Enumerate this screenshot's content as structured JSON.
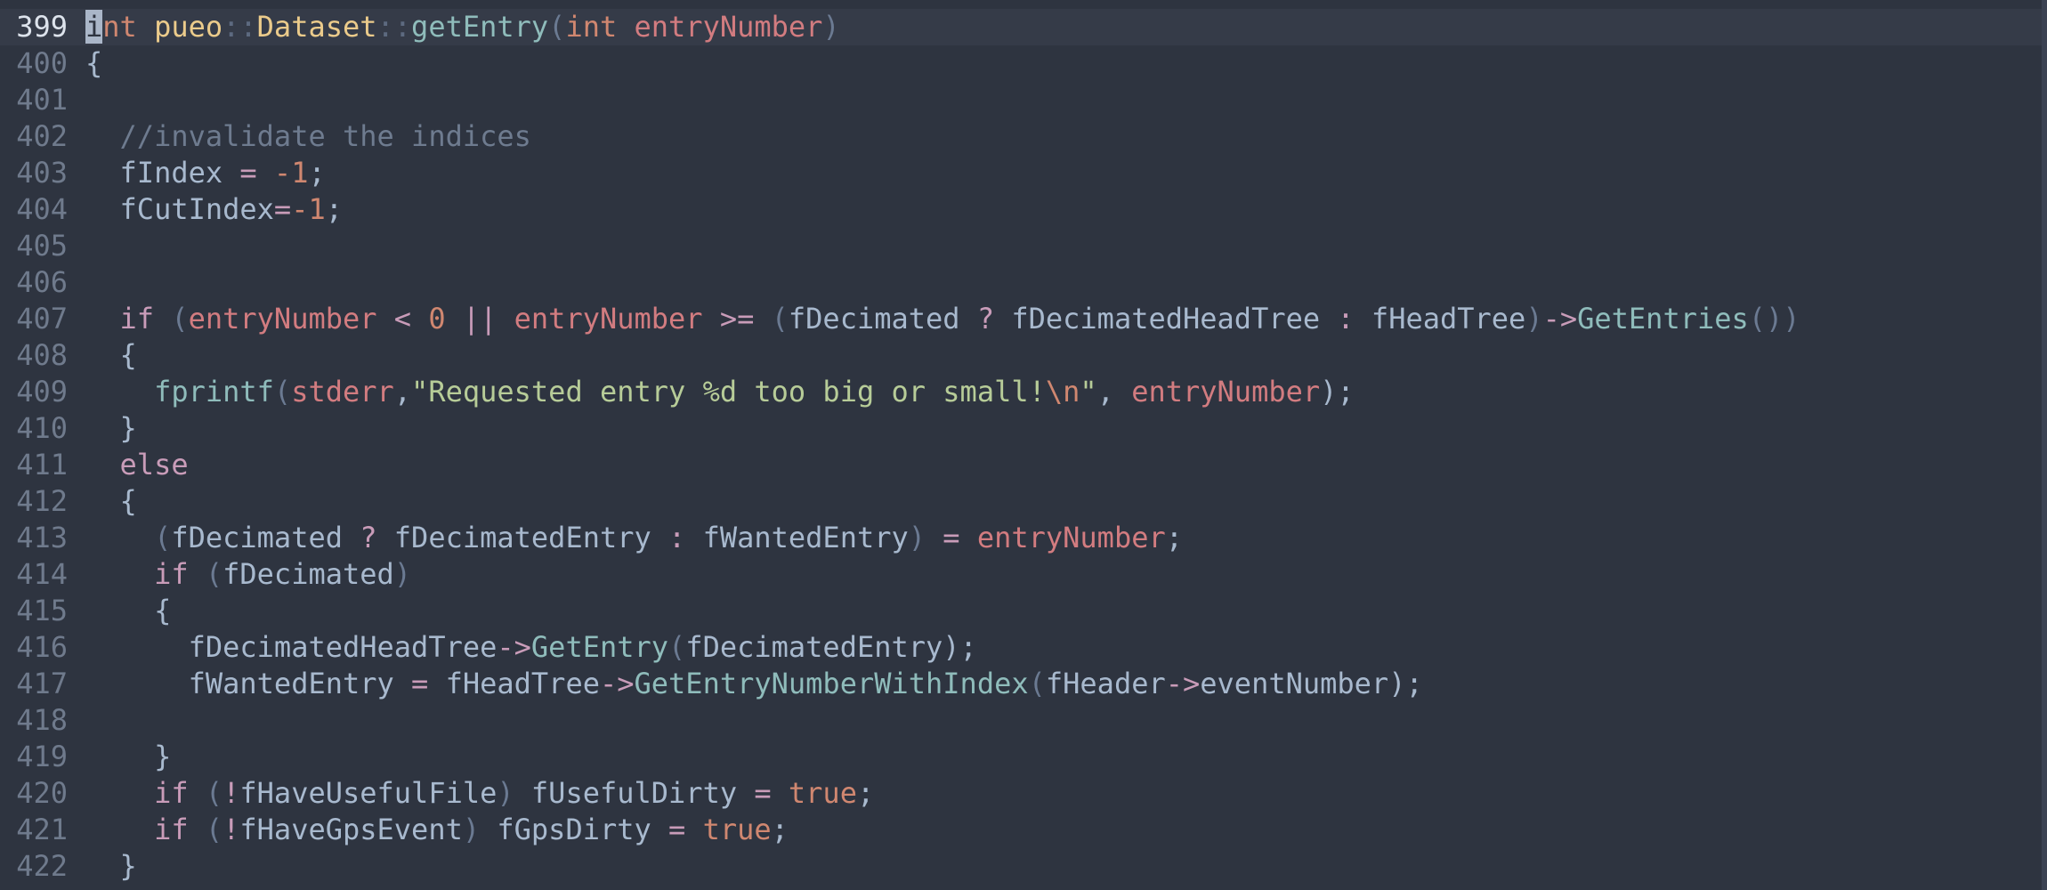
{
  "editor": {
    "current_line": "399",
    "lines": [
      {
        "num": "399",
        "tokens": [
          {
            "t": "i",
            "c": "cursor"
          },
          {
            "t": "nt",
            "c": "type"
          },
          {
            "t": " ",
            "c": "plain"
          },
          {
            "t": "pueo",
            "c": "ns"
          },
          {
            "t": "::",
            "c": "op"
          },
          {
            "t": "Dataset",
            "c": "ns"
          },
          {
            "t": "::",
            "c": "op"
          },
          {
            "t": "getEntry",
            "c": "fn"
          },
          {
            "t": "(",
            "c": "paren"
          },
          {
            "t": "int",
            "c": "type"
          },
          {
            "t": " ",
            "c": "plain"
          },
          {
            "t": "entryNumber",
            "c": "param"
          },
          {
            "t": ")",
            "c": "paren"
          }
        ]
      },
      {
        "num": "400",
        "tokens": [
          {
            "t": "{",
            "c": "plain"
          }
        ]
      },
      {
        "num": "401",
        "tokens": []
      },
      {
        "num": "402",
        "tokens": [
          {
            "t": "  //invalidate the indices",
            "c": "cmt"
          }
        ]
      },
      {
        "num": "403",
        "tokens": [
          {
            "t": "  fIndex ",
            "c": "plain"
          },
          {
            "t": "=",
            "c": "kw"
          },
          {
            "t": " ",
            "c": "plain"
          },
          {
            "t": "-1",
            "c": "num"
          },
          {
            "t": ";",
            "c": "plain"
          }
        ]
      },
      {
        "num": "404",
        "tokens": [
          {
            "t": "  fCutIndex",
            "c": "plain"
          },
          {
            "t": "=",
            "c": "kw"
          },
          {
            "t": "-1",
            "c": "num"
          },
          {
            "t": ";",
            "c": "plain"
          }
        ]
      },
      {
        "num": "405",
        "tokens": []
      },
      {
        "num": "406",
        "tokens": []
      },
      {
        "num": "407",
        "tokens": [
          {
            "t": "  if",
            "c": "kw"
          },
          {
            "t": " ",
            "c": "plain"
          },
          {
            "t": "(",
            "c": "paren"
          },
          {
            "t": "entryNumber",
            "c": "param"
          },
          {
            "t": " < ",
            "c": "kw"
          },
          {
            "t": "0",
            "c": "num"
          },
          {
            "t": " || ",
            "c": "kw"
          },
          {
            "t": "entryNumber",
            "c": "param"
          },
          {
            "t": " >= ",
            "c": "kw"
          },
          {
            "t": "(",
            "c": "paren"
          },
          {
            "t": "fDecimated",
            "c": "plain"
          },
          {
            "t": " ? ",
            "c": "kw"
          },
          {
            "t": "fDecimatedHeadTree",
            "c": "plain"
          },
          {
            "t": " : ",
            "c": "kw"
          },
          {
            "t": "fHeadTree",
            "c": "plain"
          },
          {
            "t": ")",
            "c": "paren"
          },
          {
            "t": "->",
            "c": "kw"
          },
          {
            "t": "GetEntries",
            "c": "fn"
          },
          {
            "t": "())",
            "c": "paren"
          }
        ]
      },
      {
        "num": "408",
        "tokens": [
          {
            "t": "  {",
            "c": "plain"
          }
        ]
      },
      {
        "num": "409",
        "tokens": [
          {
            "t": "    ",
            "c": "plain"
          },
          {
            "t": "fprintf",
            "c": "fn"
          },
          {
            "t": "(",
            "c": "paren"
          },
          {
            "t": "stderr",
            "c": "param"
          },
          {
            "t": ",",
            "c": "plain"
          },
          {
            "t": "\"Requested entry %d too big or small!",
            "c": "str"
          },
          {
            "t": "\\n",
            "c": "esc"
          },
          {
            "t": "\"",
            "c": "str"
          },
          {
            "t": ", ",
            "c": "plain"
          },
          {
            "t": "entryNumber",
            "c": "param"
          },
          {
            "t": ");",
            "c": "plain"
          }
        ]
      },
      {
        "num": "410",
        "tokens": [
          {
            "t": "  }",
            "c": "plain"
          }
        ]
      },
      {
        "num": "411",
        "tokens": [
          {
            "t": "  else",
            "c": "kw"
          }
        ]
      },
      {
        "num": "412",
        "tokens": [
          {
            "t": "  {",
            "c": "plain"
          }
        ]
      },
      {
        "num": "413",
        "tokens": [
          {
            "t": "    ",
            "c": "plain"
          },
          {
            "t": "(",
            "c": "paren"
          },
          {
            "t": "fDecimated",
            "c": "plain"
          },
          {
            "t": " ? ",
            "c": "kw"
          },
          {
            "t": "fDecimatedEntry",
            "c": "plain"
          },
          {
            "t": " : ",
            "c": "kw"
          },
          {
            "t": "fWantedEntry",
            "c": "plain"
          },
          {
            "t": ")",
            "c": "paren"
          },
          {
            "t": " = ",
            "c": "kw"
          },
          {
            "t": "entryNumber",
            "c": "param"
          },
          {
            "t": ";",
            "c": "plain"
          }
        ]
      },
      {
        "num": "414",
        "tokens": [
          {
            "t": "    if",
            "c": "kw"
          },
          {
            "t": " ",
            "c": "plain"
          },
          {
            "t": "(",
            "c": "paren"
          },
          {
            "t": "fDecimated",
            "c": "plain"
          },
          {
            "t": ")",
            "c": "paren"
          }
        ]
      },
      {
        "num": "415",
        "tokens": [
          {
            "t": "    {",
            "c": "plain"
          }
        ]
      },
      {
        "num": "416",
        "tokens": [
          {
            "t": "      fDecimatedHeadTree",
            "c": "plain"
          },
          {
            "t": "->",
            "c": "kw"
          },
          {
            "t": "GetEntry",
            "c": "fn"
          },
          {
            "t": "(",
            "c": "paren"
          },
          {
            "t": "fDecimatedEntry",
            "c": "plain"
          },
          {
            "t": ");",
            "c": "plain"
          }
        ]
      },
      {
        "num": "417",
        "tokens": [
          {
            "t": "      fWantedEntry ",
            "c": "plain"
          },
          {
            "t": "=",
            "c": "kw"
          },
          {
            "t": " fHeadTree",
            "c": "plain"
          },
          {
            "t": "->",
            "c": "kw"
          },
          {
            "t": "GetEntryNumberWithIndex",
            "c": "fn"
          },
          {
            "t": "(",
            "c": "paren"
          },
          {
            "t": "fHeader",
            "c": "plain"
          },
          {
            "t": "->",
            "c": "kw"
          },
          {
            "t": "eventNumber",
            "c": "plain"
          },
          {
            "t": ");",
            "c": "plain"
          }
        ]
      },
      {
        "num": "418",
        "tokens": []
      },
      {
        "num": "419",
        "tokens": [
          {
            "t": "    }",
            "c": "plain"
          }
        ]
      },
      {
        "num": "420",
        "tokens": [
          {
            "t": "    if",
            "c": "kw"
          },
          {
            "t": " ",
            "c": "plain"
          },
          {
            "t": "(",
            "c": "paren"
          },
          {
            "t": "!",
            "c": "kw"
          },
          {
            "t": "fHaveUsefulFile",
            "c": "plain"
          },
          {
            "t": ")",
            "c": "paren"
          },
          {
            "t": " fUsefulDirty ",
            "c": "plain"
          },
          {
            "t": "=",
            "c": "kw"
          },
          {
            "t": " ",
            "c": "plain"
          },
          {
            "t": "true",
            "c": "num"
          },
          {
            "t": ";",
            "c": "plain"
          }
        ]
      },
      {
        "num": "421",
        "tokens": [
          {
            "t": "    if",
            "c": "kw"
          },
          {
            "t": " ",
            "c": "plain"
          },
          {
            "t": "(",
            "c": "paren"
          },
          {
            "t": "!",
            "c": "kw"
          },
          {
            "t": "fHaveGpsEvent",
            "c": "plain"
          },
          {
            "t": ")",
            "c": "paren"
          },
          {
            "t": " fGpsDirty ",
            "c": "plain"
          },
          {
            "t": "=",
            "c": "kw"
          },
          {
            "t": " ",
            "c": "plain"
          },
          {
            "t": "true",
            "c": "num"
          },
          {
            "t": ";",
            "c": "plain"
          }
        ]
      },
      {
        "num": "422",
        "tokens": [
          {
            "t": "  }",
            "c": "plain"
          }
        ]
      }
    ]
  }
}
